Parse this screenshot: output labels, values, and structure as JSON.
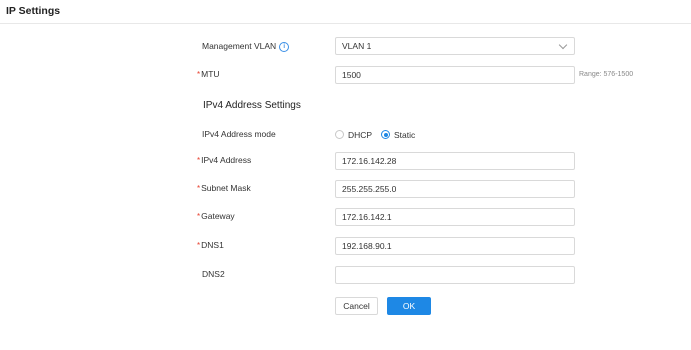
{
  "header": {
    "title": "IP Settings"
  },
  "form": {
    "management_vlan": {
      "label": "Management VLAN",
      "value": "VLAN 1"
    },
    "mtu": {
      "label": "MTU",
      "value": "1500",
      "hint": "Range: 576-1500"
    },
    "ipv4_section_title": "IPv4 Address Settings",
    "ipv4_mode": {
      "label": "IPv4 Address mode",
      "options": [
        "DHCP",
        "Static"
      ],
      "selected": "Static"
    },
    "ipv4_address": {
      "label": "IPv4 Address",
      "value": "172.16.142.28"
    },
    "subnet_mask": {
      "label": "Subnet Mask",
      "value": "255.255.255.0"
    },
    "gateway": {
      "label": "Gateway",
      "value": "172.16.142.1"
    },
    "dns1": {
      "label": "DNS1",
      "value": "192.168.90.1"
    },
    "dns2": {
      "label": "DNS2",
      "value": ""
    },
    "required_marker": "*"
  },
  "actions": {
    "cancel_label": "Cancel",
    "ok_label": "OK"
  },
  "colors": {
    "accent": "#1e88e5",
    "required": "#e8402f"
  }
}
